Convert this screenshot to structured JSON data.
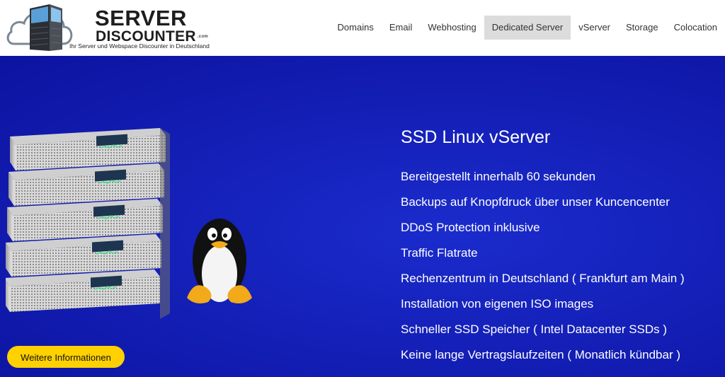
{
  "logo": {
    "line1": "SERVER",
    "line2": "DISCOUNTER",
    "tld": ".com",
    "tagline": "Ihr Server und Webspace Discounter in Deutschland"
  },
  "nav": {
    "items": [
      {
        "label": "Domains"
      },
      {
        "label": "Email"
      },
      {
        "label": "Webhosting"
      },
      {
        "label": "Dedicated Server",
        "active": true
      },
      {
        "label": "vServer"
      },
      {
        "label": "Storage"
      },
      {
        "label": "Colocation"
      }
    ]
  },
  "hero": {
    "title": "SSD Linux vServer",
    "features": [
      "Bereitgestellt innerhalb 60 sekunden",
      "Backups auf Knopfdruck über unser Kuncencenter",
      "DDoS Protection inklusive",
      "Traffic Flatrate",
      "Rechenzentrum in Deutschland ( Frankfurt am Main )",
      "Installation von eigenen ISO images",
      "Schneller SSD Speicher ( Intel Datacenter SSDs )",
      "Keine lange Vertragslaufzeiten ( Monatlich kündbar )"
    ],
    "cta_label": "Weitere Informationen"
  },
  "colors": {
    "hero_bg": "#1420b8",
    "cta_bg": "#ffd100",
    "nav_active_bg": "#dcdcdc"
  },
  "icons": [
    "cloud-icon",
    "server-building-icon",
    "server-rack-icon",
    "tux-penguin-icon"
  ]
}
